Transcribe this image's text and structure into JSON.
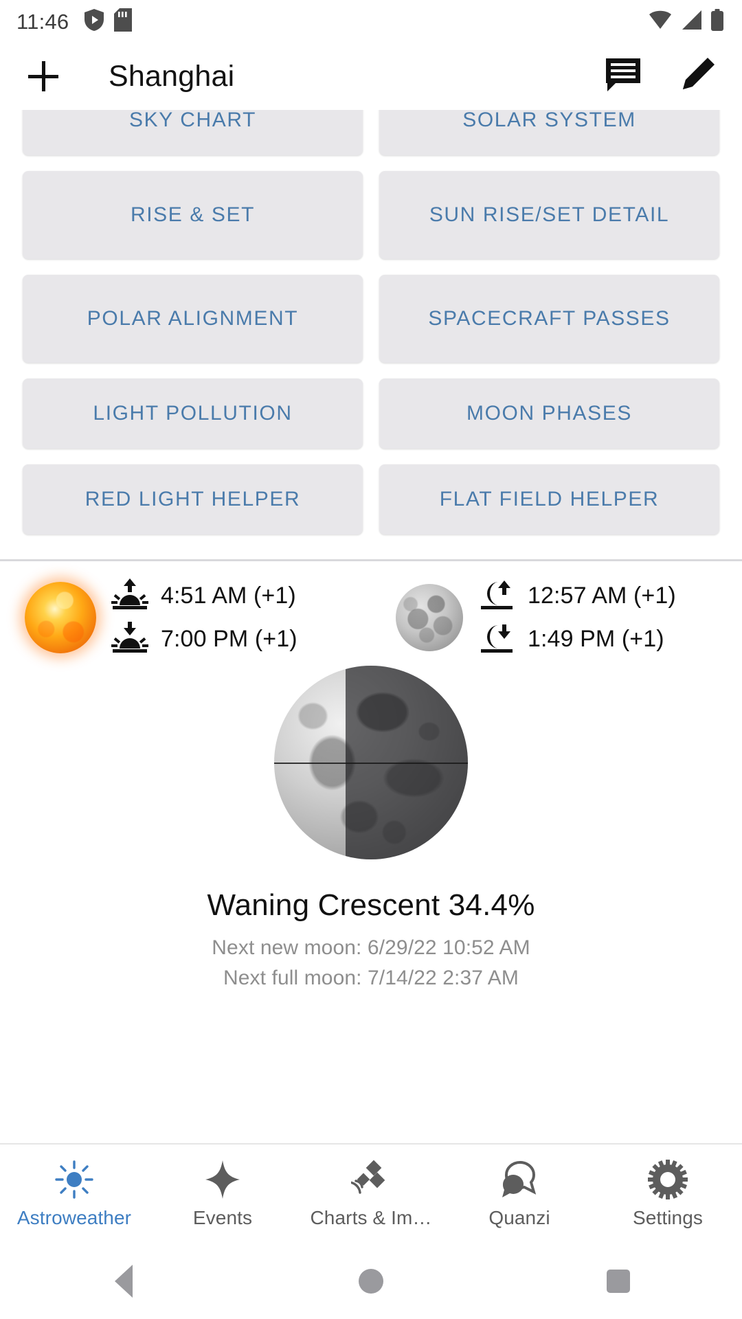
{
  "statusbar": {
    "time": "11:46",
    "left_icons": [
      "shield-play-icon",
      "sd-card-icon"
    ],
    "right_icons": [
      "wifi-icon",
      "cellular-signal-icon",
      "battery-icon"
    ]
  },
  "appbar": {
    "add_label": "+",
    "title": "Shanghai",
    "actions": [
      "comment-icon",
      "edit-pencil-icon"
    ]
  },
  "grid": {
    "buttons": [
      {
        "label": "SKY CHART"
      },
      {
        "label": "SOLAR SYSTEM"
      },
      {
        "label": "RISE & SET"
      },
      {
        "label": "SUN RISE/SET DETAIL"
      },
      {
        "label": "POLAR ALIGNMENT"
      },
      {
        "label": "SPACECRAFT PASSES"
      },
      {
        "label": "LIGHT POLLUTION"
      },
      {
        "label": "MOON PHASES"
      },
      {
        "label": "RED LIGHT HELPER"
      },
      {
        "label": "FLAT FIELD HELPER"
      }
    ],
    "accent_color": "#4a7bab",
    "button_bg": "#e8e7ea"
  },
  "riseset": {
    "sun": {
      "body_icon": "sun-disc-icon",
      "rise_icon": "sunrise-icon",
      "rise_time": "4:51 AM (+1)",
      "set_icon": "sunset-icon",
      "set_time": "7:00 PM (+1)"
    },
    "moon": {
      "body_icon": "moon-disc-icon",
      "rise_icon": "moonrise-icon",
      "rise_time": "12:57 AM (+1)",
      "set_icon": "moonset-icon",
      "set_time": "1:49 PM (+1)"
    }
  },
  "moon_phase": {
    "image_icon": "waning-crescent-moon-image",
    "title": "Waning Crescent 34.4%",
    "next_new_moon": "Next new moon: 6/29/22 10:52 AM",
    "next_full_moon": "Next full moon: 7/14/22 2:37 AM"
  },
  "bottomnav": {
    "active_color": "#3e7ec2",
    "inactive_color": "#5d5d5d",
    "items": [
      {
        "label": "Astroweather",
        "icon": "sun-rays-icon",
        "active": true
      },
      {
        "label": "Events",
        "icon": "four-point-star-icon",
        "active": false
      },
      {
        "label": "Charts & Im…",
        "icon": "satellite-icon",
        "active": false
      },
      {
        "label": "Quanzi",
        "icon": "speech-bubbles-icon",
        "active": false
      },
      {
        "label": "Settings",
        "icon": "gear-icon",
        "active": false
      }
    ]
  },
  "sysnav": {
    "back": "back-triangle-icon",
    "home": "home-circle-icon",
    "recent": "recents-square-icon"
  }
}
